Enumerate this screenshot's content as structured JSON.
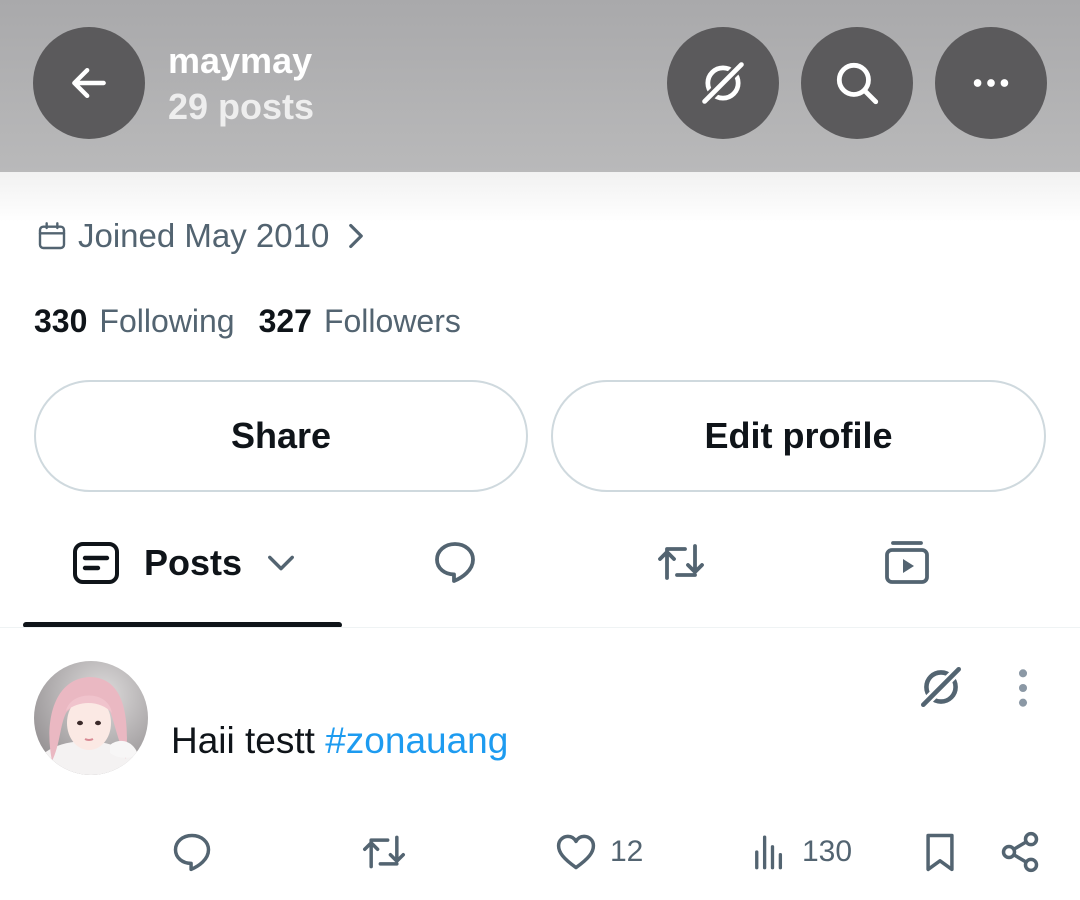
{
  "header": {
    "name": "maymay",
    "post_count": "29 posts",
    "icons": [
      "back-arrow-icon",
      "grok-icon",
      "search-icon",
      "more-icon"
    ]
  },
  "profile": {
    "joined": "Joined May 2010",
    "following_count": "330",
    "following_label": "Following",
    "followers_count": "327",
    "followers_label": "Followers"
  },
  "buttons": {
    "share": "Share",
    "edit_profile": "Edit profile"
  },
  "tabs": {
    "posts_label": "Posts",
    "icons": [
      "posts-icon",
      "replies-icon",
      "reposts-icon",
      "media-icon"
    ]
  },
  "post": {
    "text": "Haii testt ",
    "hashtag": "#zonauang",
    "likes": "12",
    "views": "130"
  },
  "colors": {
    "header_bg": "#a9a9ab",
    "circle_btn": "#5b5a5c",
    "secondary_text": "#536471",
    "link": "#1d9bf0",
    "border": "#cfd9de"
  }
}
